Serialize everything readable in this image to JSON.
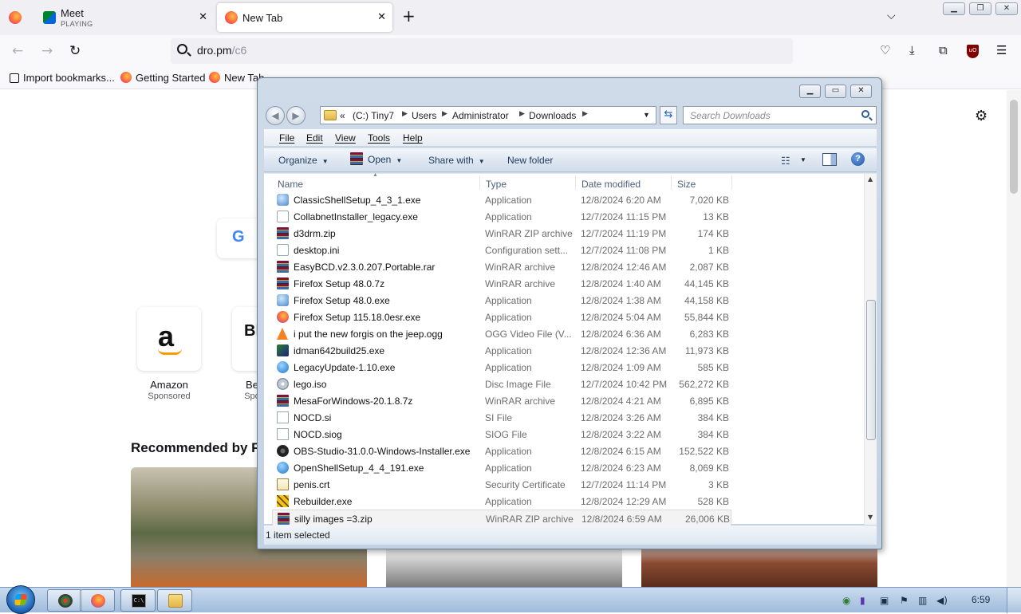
{
  "firefox": {
    "tabs": [
      {
        "title": "Meet",
        "subtitle": "PLAYING"
      },
      {
        "title": "New Tab"
      }
    ],
    "url": {
      "host": "dro.pm",
      "path": "/c6"
    },
    "bookmarks": [
      "Import bookmarks...",
      "Getting Started",
      "New Tab"
    ],
    "ublock_label": "uO",
    "page": {
      "shortcuts": [
        {
          "label": "Amazon",
          "sub": "Sponsored",
          "glyph": "a"
        },
        {
          "label": "Be",
          "sub": "Spo",
          "glyph": "Bl B"
        }
      ],
      "google_glyph": "G",
      "recommended_heading": "Recommended by Po"
    }
  },
  "explorer": {
    "breadcrumb": [
      "«",
      "(C:) Tiny7",
      "Users",
      "Administrator",
      "Downloads"
    ],
    "search_placeholder": "Search Downloads",
    "menu": [
      "File",
      "Edit",
      "View",
      "Tools",
      "Help"
    ],
    "commands": {
      "organize": "Organize",
      "open": "Open",
      "share": "Share with",
      "new_folder": "New folder"
    },
    "columns": [
      "Name",
      "Type",
      "Date modified",
      "Size"
    ],
    "files": [
      {
        "name": "ClassicShellSetup_4_3_1.exe",
        "type": "Application",
        "date": "12/8/2024 6:20 AM",
        "size": "7,020 KB",
        "icon": "app-icon"
      },
      {
        "name": "CollabnetInstaller_legacy.exe",
        "type": "Application",
        "date": "12/7/2024 11:15 PM",
        "size": "13 KB",
        "icon": "installer-icon"
      },
      {
        "name": "d3drm.zip",
        "type": "WinRAR ZIP archive",
        "date": "12/7/2024 11:19 PM",
        "size": "174 KB",
        "icon": "winrar-icon"
      },
      {
        "name": "desktop.ini",
        "type": "Configuration sett...",
        "date": "12/7/2024 11:08 PM",
        "size": "1 KB",
        "icon": "settings-file-icon"
      },
      {
        "name": "EasyBCD.v2.3.0.207.Portable.rar",
        "type": "WinRAR archive",
        "date": "12/8/2024 12:46 AM",
        "size": "2,087 KB",
        "icon": "winrar-icon"
      },
      {
        "name": "Firefox Setup 48.0.7z",
        "type": "WinRAR archive",
        "date": "12/8/2024 1:40 AM",
        "size": "44,145 KB",
        "icon": "winrar-icon"
      },
      {
        "name": "Firefox Setup 48.0.exe",
        "type": "Application",
        "date": "12/8/2024 1:38 AM",
        "size": "44,158 KB",
        "icon": "setup-icon"
      },
      {
        "name": "Firefox Setup 115.18.0esr.exe",
        "type": "Application",
        "date": "12/8/2024 5:04 AM",
        "size": "55,844 KB",
        "icon": "firefox-icon"
      },
      {
        "name": "i put the new forgis on the jeep.ogg",
        "type": "OGG Video File (V...",
        "date": "12/8/2024 6:36 AM",
        "size": "6,283 KB",
        "icon": "vlc-icon"
      },
      {
        "name": "idman642build25.exe",
        "type": "Application",
        "date": "12/8/2024 12:36 AM",
        "size": "11,973 KB",
        "icon": "idm-icon"
      },
      {
        "name": "LegacyUpdate-1.10.exe",
        "type": "Application",
        "date": "12/8/2024 1:09 AM",
        "size": "585 KB",
        "icon": "globe-icon"
      },
      {
        "name": "lego.iso",
        "type": "Disc Image File",
        "date": "12/7/2024 10:42 PM",
        "size": "562,272 KB",
        "icon": "disc-icon"
      },
      {
        "name": "MesaForWindows-20.1.8.7z",
        "type": "WinRAR archive",
        "date": "12/8/2024 4:21 AM",
        "size": "6,895 KB",
        "icon": "winrar-icon"
      },
      {
        "name": "NOCD.si",
        "type": "SI File",
        "date": "12/8/2024 3:26 AM",
        "size": "384 KB",
        "icon": "blank-file-icon"
      },
      {
        "name": "NOCD.siog",
        "type": "SIOG File",
        "date": "12/8/2024 3:22 AM",
        "size": "384 KB",
        "icon": "blank-file-icon"
      },
      {
        "name": "OBS-Studio-31.0.0-Windows-Installer.exe",
        "type": "Application",
        "date": "12/8/2024 6:15 AM",
        "size": "152,522 KB",
        "icon": "obs-icon"
      },
      {
        "name": "OpenShellSetup_4_4_191.exe",
        "type": "Application",
        "date": "12/8/2024 6:23 AM",
        "size": "8,069 KB",
        "icon": "shell-icon"
      },
      {
        "name": "penis.crt",
        "type": "Security Certificate",
        "date": "12/7/2024 11:14 PM",
        "size": "3 KB",
        "icon": "certificate-icon"
      },
      {
        "name": "Rebuilder.exe",
        "type": "Application",
        "date": "12/8/2024 12:29 AM",
        "size": "528 KB",
        "icon": "rebuilder-icon"
      },
      {
        "name": "silly images =3.zip",
        "type": "WinRAR ZIP archive",
        "date": "12/8/2024 6:59 AM",
        "size": "26,006 KB",
        "icon": "winrar-icon",
        "selected": true
      }
    ],
    "status": "1 item selected"
  },
  "taskbar": {
    "clock": "6:59",
    "cmd_label": "C:\\"
  }
}
